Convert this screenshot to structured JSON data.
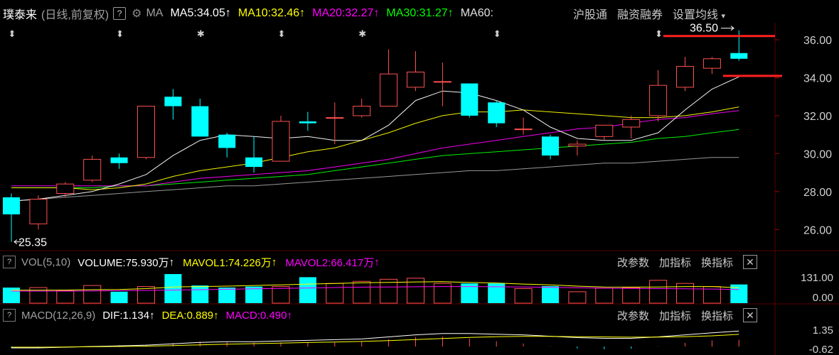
{
  "header": {
    "stock_name": "璞泰来",
    "period": "(日线,前复权)",
    "help": "?",
    "ma_label": "MA",
    "ma5": "MA5:34.05",
    "ma10": "MA10:32.46",
    "ma20": "MA20:32.27",
    "ma30": "MA30:31.27",
    "ma60": "MA60:",
    "links": [
      "沪股通",
      "融资融券",
      "设置均线"
    ],
    "arrow": "↑"
  },
  "colors": {
    "ma5": "#ffffff",
    "ma10": "#ffff00",
    "ma20": "#ff00ff",
    "ma30": "#00ff00",
    "ma60": "#a0a0a0",
    "up": "#ff5050",
    "down": "#00ffff",
    "mark": "#ff2020"
  },
  "volume_panel": {
    "label": "VOL(5,10)",
    "volume": "VOLUME:75.930万",
    "mavol1": "MAVOL1:74.226万",
    "mavol2": "MAVOL2:66.417万",
    "actions": [
      "改参数",
      "加指标",
      "换指标"
    ],
    "close": "✕",
    "scale_top": "131.00",
    "scale_bottom": "0.00"
  },
  "macd_panel": {
    "label": "MACD(12,26,9)",
    "dif": "DIF:1.134",
    "dea": "DEA:0.889",
    "macd": "MACD:0.490",
    "actions": [
      "改参数",
      "加指标",
      "换指标"
    ],
    "close": "✕",
    "scale_top": "1.35",
    "scale_bottom": "-0.62"
  },
  "chart_data": {
    "type": "candlestick",
    "y_ticks": [
      36.0,
      34.0,
      32.0,
      30.0,
      28.0,
      26.0
    ],
    "y_tick_labels": [
      "36.00",
      "34.00",
      "32.00",
      "30.00",
      "28.00",
      "26.00"
    ],
    "ylim": [
      25.0,
      36.9
    ],
    "annotations": {
      "high": "36.50",
      "low": "25.35",
      "high_value": 36.5,
      "low_value": 25.35
    },
    "candles": [
      {
        "o": 27.7,
        "c": 26.8,
        "h": 27.9,
        "l": 25.35
      },
      {
        "o": 26.3,
        "c": 27.6,
        "h": 27.8,
        "l": 26.0
      },
      {
        "o": 27.9,
        "c": 28.4,
        "h": 28.5,
        "l": 27.7
      },
      {
        "o": 28.6,
        "c": 29.7,
        "h": 29.9,
        "l": 28.5
      },
      {
        "o": 29.8,
        "c": 29.5,
        "h": 30.0,
        "l": 29.2
      },
      {
        "o": 29.8,
        "c": 32.5,
        "h": 32.5,
        "l": 29.7
      },
      {
        "o": 33.0,
        "c": 32.5,
        "h": 33.4,
        "l": 31.8
      },
      {
        "o": 32.5,
        "c": 30.9,
        "h": 32.9,
        "l": 30.9
      },
      {
        "o": 31.0,
        "c": 30.3,
        "h": 31.1,
        "l": 29.8
      },
      {
        "o": 29.8,
        "c": 29.3,
        "h": 30.9,
        "l": 29.0
      },
      {
        "o": 29.6,
        "c": 31.7,
        "h": 32.0,
        "l": 29.6
      },
      {
        "o": 31.7,
        "c": 31.6,
        "h": 32.2,
        "l": 31.2
      },
      {
        "o": 31.9,
        "c": 31.9,
        "h": 32.7,
        "l": 30.5
      },
      {
        "o": 32.0,
        "c": 32.5,
        "h": 32.9,
        "l": 31.9
      },
      {
        "o": 32.5,
        "c": 34.2,
        "h": 35.5,
        "l": 32.5
      },
      {
        "o": 33.5,
        "c": 34.3,
        "h": 35.4,
        "l": 33.3
      },
      {
        "o": 33.8,
        "c": 33.8,
        "h": 34.8,
        "l": 32.5
      },
      {
        "o": 33.7,
        "c": 32.0,
        "h": 33.7,
        "l": 31.9
      },
      {
        "o": 32.7,
        "c": 31.6,
        "h": 32.8,
        "l": 31.4
      },
      {
        "o": 31.3,
        "c": 31.3,
        "h": 31.9,
        "l": 31.0
      },
      {
        "o": 30.9,
        "c": 29.9,
        "h": 31.0,
        "l": 29.7
      },
      {
        "o": 30.4,
        "c": 30.5,
        "h": 30.7,
        "l": 29.9
      },
      {
        "o": 30.9,
        "c": 31.5,
        "h": 31.5,
        "l": 30.7
      },
      {
        "o": 31.4,
        "c": 31.8,
        "h": 32.0,
        "l": 30.8
      },
      {
        "o": 32.0,
        "c": 33.6,
        "h": 34.4,
        "l": 31.7
      },
      {
        "o": 33.5,
        "c": 34.6,
        "h": 35.1,
        "l": 33.3
      },
      {
        "o": 34.5,
        "c": 35.0,
        "h": 35.1,
        "l": 34.2
      },
      {
        "o": 35.3,
        "c": 35.0,
        "h": 36.5,
        "l": 34.9
      }
    ],
    "ma_lines": {
      "ma5": [
        27.5,
        27.6,
        27.8,
        28.0,
        28.4,
        28.9,
        29.9,
        30.7,
        31.0,
        30.9,
        30.8,
        30.9,
        30.7,
        30.7,
        31.5,
        32.8,
        33.3,
        33.2,
        32.8,
        32.3,
        31.4,
        30.8,
        30.7,
        30.7,
        31.1,
        32.3,
        33.4,
        34.05
      ],
      "ma10": [
        28.2,
        28.2,
        28.2,
        28.1,
        28.2,
        28.4,
        28.8,
        29.1,
        29.3,
        29.5,
        29.8,
        30.1,
        30.3,
        30.7,
        31.1,
        31.6,
        32.0,
        32.2,
        32.2,
        32.3,
        32.2,
        32.1,
        32.0,
        31.9,
        31.9,
        32.0,
        32.2,
        32.46
      ],
      "ma20": [
        28.3,
        28.3,
        28.3,
        28.3,
        28.3,
        28.3,
        28.5,
        28.7,
        28.8,
        28.9,
        29.0,
        29.1,
        29.3,
        29.5,
        29.7,
        30.0,
        30.3,
        30.5,
        30.7,
        30.9,
        31.1,
        31.3,
        31.4,
        31.6,
        31.8,
        31.9,
        32.1,
        32.27
      ],
      "ma30": [
        28.2,
        28.2,
        28.2,
        28.2,
        28.3,
        28.3,
        28.4,
        28.5,
        28.6,
        28.7,
        28.8,
        28.9,
        29.1,
        29.3,
        29.5,
        29.7,
        29.9,
        30.0,
        30.1,
        30.2,
        30.3,
        30.4,
        30.5,
        30.6,
        30.8,
        30.9,
        31.1,
        31.27
      ],
      "ma60": [
        27.5,
        27.6,
        27.7,
        27.8,
        27.9,
        28.0,
        28.1,
        28.2,
        28.3,
        28.3,
        28.4,
        28.5,
        28.6,
        28.7,
        28.8,
        28.9,
        29.0,
        29.1,
        29.1,
        29.2,
        29.3,
        29.4,
        29.5,
        29.5,
        29.6,
        29.7,
        29.8,
        29.8
      ]
    },
    "volume": {
      "ylim": [
        0,
        140
      ],
      "bars": [
        75,
        75,
        60,
        85,
        55,
        80,
        140,
        85,
        75,
        80,
        80,
        125,
        95,
        105,
        115,
        120,
        95,
        95,
        95,
        70,
        82,
        55,
        72,
        75,
        110,
        95,
        80,
        90
      ],
      "mavol1": [
        62,
        62,
        63,
        65,
        66,
        70,
        78,
        80,
        82,
        85,
        88,
        92,
        95,
        98,
        100,
        102,
        103,
        100,
        97,
        92,
        88,
        82,
        78,
        77,
        78,
        80,
        80,
        74
      ],
      "mavol2": [
        58,
        58,
        58,
        59,
        60,
        61,
        63,
        65,
        67,
        69,
        71,
        73,
        75,
        77,
        78,
        79,
        80,
        80,
        79,
        78,
        76,
        74,
        72,
        71,
        70,
        69,
        68,
        66
      ]
    },
    "macd": {
      "ylim": [
        -0.62,
        1.35
      ],
      "dif": [
        -0.1,
        -0.1,
        -0.05,
        0.0,
        0.05,
        0.1,
        0.2,
        0.3,
        0.35,
        0.35,
        0.4,
        0.45,
        0.5,
        0.55,
        0.7,
        0.85,
        0.95,
        0.95,
        0.9,
        0.85,
        0.75,
        0.65,
        0.6,
        0.6,
        0.7,
        0.85,
        1.0,
        1.134
      ],
      "dea": [
        -0.05,
        -0.05,
        -0.04,
        -0.02,
        0.0,
        0.03,
        0.07,
        0.12,
        0.17,
        0.21,
        0.25,
        0.29,
        0.33,
        0.37,
        0.43,
        0.51,
        0.59,
        0.66,
        0.71,
        0.74,
        0.74,
        0.72,
        0.7,
        0.68,
        0.69,
        0.72,
        0.78,
        0.889
      ],
      "hist": [
        -0.1,
        -0.1,
        -0.02,
        0.04,
        0.1,
        0.14,
        0.26,
        0.36,
        0.36,
        0.28,
        0.3,
        0.32,
        0.34,
        0.36,
        0.54,
        0.68,
        0.72,
        0.58,
        0.38,
        0.22,
        0.02,
        -0.14,
        -0.2,
        -0.16,
        0.02,
        0.26,
        0.44,
        0.49
      ]
    }
  }
}
